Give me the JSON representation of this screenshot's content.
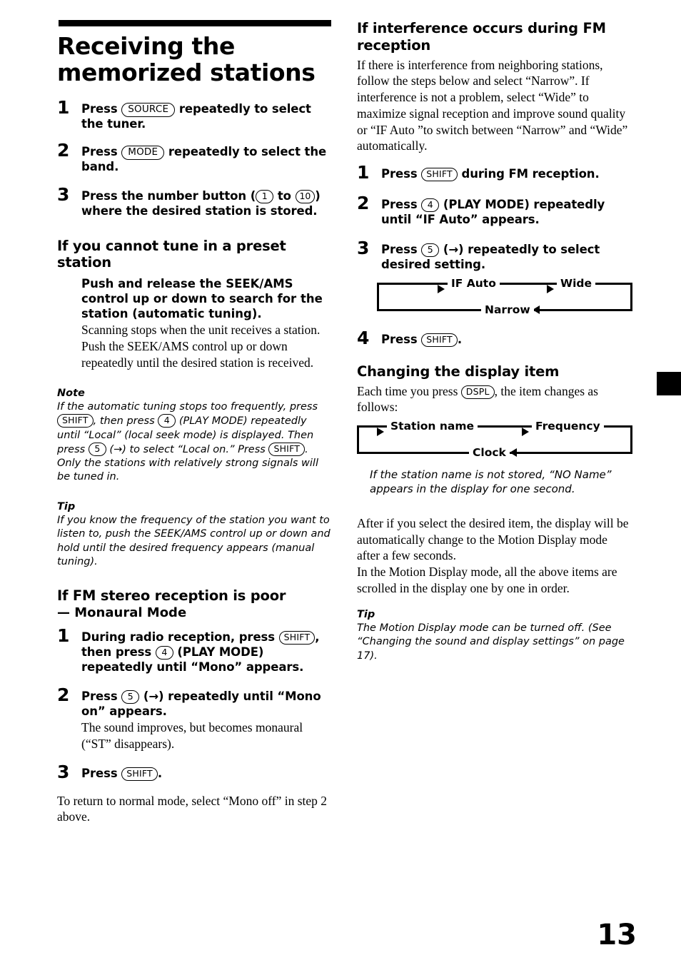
{
  "page": {
    "number": "13"
  },
  "left_column": {
    "title": "Receiving the memorized stations",
    "steps": [
      {
        "num": "1",
        "lead_pre": "Press",
        "pill": "SOURCE",
        "lead_post": "repeatedly to select the tuner."
      },
      {
        "num": "2",
        "lead_pre": "Press",
        "pill": "MODE",
        "lead_post": "repeatedly to select the band."
      },
      {
        "num": "3",
        "lead_pre": "Press the number button (",
        "circ_from": "1",
        "lead_mid": "to",
        "circ_to": "10",
        "lead_post": ") where the desired station is stored."
      }
    ],
    "preset_section": {
      "heading": "If you cannot tune in a preset station",
      "bold_lead": "Push and release the SEEK/AMS control up or down to search for the station (automatic tuning).",
      "body": "Scanning stops when the unit receives a station. Push the SEEK/AMS control up or down repeatedly until the desired station is received."
    },
    "note": {
      "label": "Note",
      "t1": "If the automatic tuning stops too frequently, press",
      "pill1": "SHIFT",
      "t2": ", then press",
      "circ1": "4",
      "t3": "(PLAY MODE) repeatedly until “Local” (local seek mode) is displayed. Then press",
      "circ2": "5",
      "t4": "(→) to select “Local on.” Press",
      "pill2": "SHIFT",
      "t5": ". Only the stations with relatively strong signals will be tuned in."
    },
    "tip": {
      "label": "Tip",
      "text": "If you know the frequency of the station you want to listen to, push the SEEK/AMS control up or down and hold until the desired frequency appears (manual tuning)."
    },
    "mono_section": {
      "heading": "If FM stereo reception is poor",
      "subheading": "— Monaural Mode",
      "steps": [
        {
          "num": "1",
          "t1": "During radio reception, press",
          "pill1": "SHIFT",
          "t2": ", then press",
          "circ1": "4",
          "t3": "(PLAY MODE) repeatedly until “Mono” appears."
        },
        {
          "num": "2",
          "t1": "Press",
          "circ1": "5",
          "t2": "(→) repeatedly until “Mono on” appears.",
          "body": "The sound improves, but becomes monaural (“ST” disappears)."
        },
        {
          "num": "3",
          "t1": "Press",
          "pill1": "SHIFT",
          "t2": "."
        }
      ],
      "closing": "To return to normal mode, select “Mono off” in step 2 above."
    }
  },
  "right_column": {
    "interference_section": {
      "heading": "If interference occurs during FM reception",
      "body": "If there is interference from neighboring stations, follow the steps below and select “Narrow”. If interference is not a problem, select “Wide” to maximize signal reception and improve sound quality or “IF Auto ”to switch between “Narrow” and “Wide” automatically.",
      "steps": [
        {
          "num": "1",
          "t1": "Press",
          "pill1": "SHIFT",
          "t2": "during FM reception."
        },
        {
          "num": "2",
          "t1": "Press",
          "circ1": "4",
          "t2": "(PLAY MODE) repeatedly until “IF Auto” appears."
        },
        {
          "num": "3",
          "t1": "Press",
          "circ1": "5",
          "t2": "(→) repeatedly to select desired setting."
        },
        {
          "num": "4",
          "t1": "Press",
          "pill1": "SHIFT",
          "t2": "."
        }
      ],
      "cycle": {
        "top": [
          "IF Auto",
          "Wide"
        ],
        "bottom": [
          "Narrow"
        ]
      }
    },
    "display_section": {
      "heading": "Changing the display item",
      "intro_pre": "Each time you press",
      "intro_pill": "DSPL",
      "intro_post": ", the item changes as follows:",
      "cycle": {
        "top": [
          "Station name",
          "Frequency"
        ],
        "bottom": [
          "Clock"
        ]
      },
      "note_italic": "If the station name is not stored, “NO Name” appears in the display for one second.",
      "body": "After if you select the desired item, the display will be automatically change to the Motion Display mode after a few seconds.\nIn the Motion Display mode, all the above items are scrolled in the display one by one in order.",
      "tip": {
        "label": "Tip",
        "text": "The Motion Display mode can be turned off. (See “Changing the sound and display settings” on page 17)."
      }
    }
  }
}
